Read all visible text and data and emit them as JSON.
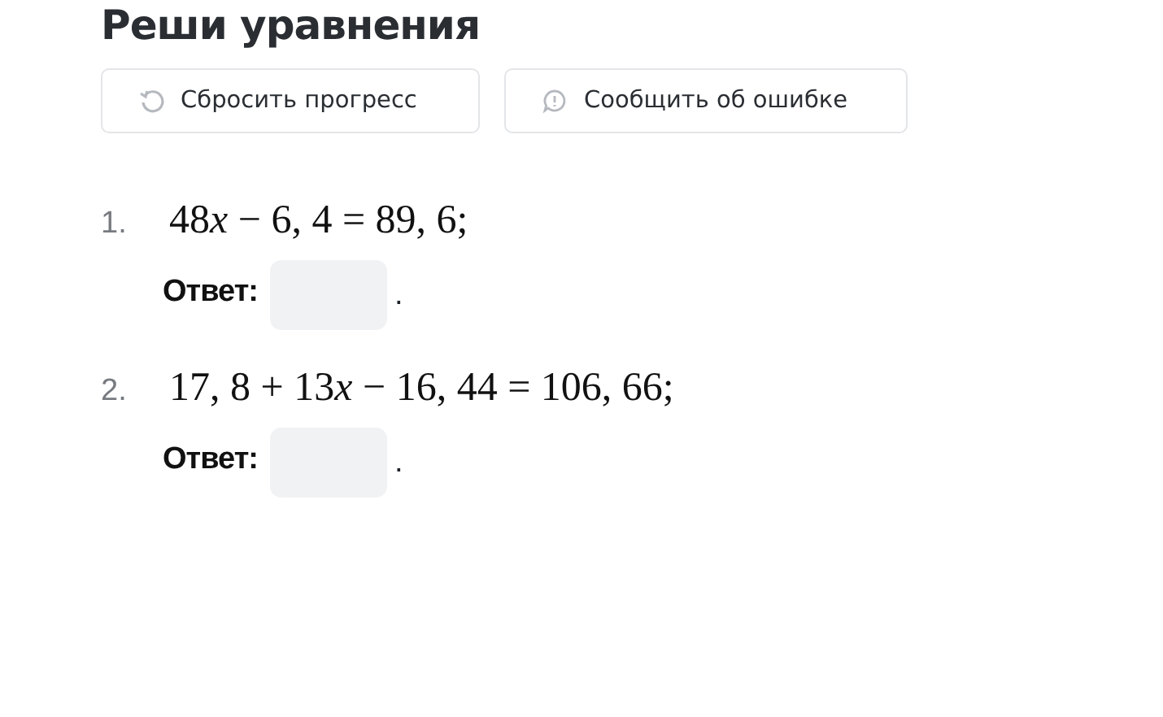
{
  "title": "Реши уравнения",
  "buttons": [
    {
      "kind": "reset",
      "label": "Сбросить прогресс"
    },
    {
      "kind": "report",
      "label": "Сообщить об ошибке"
    }
  ],
  "tasks": [
    {
      "number": "1.",
      "equation": [
        {
          "kind": "text",
          "text": "48"
        },
        {
          "kind": "variable",
          "text": "x"
        },
        {
          "kind": "text",
          "text": " − 6, 4 = 89, 6;"
        }
      ],
      "answer_label": "Ответ:",
      "after": "."
    },
    {
      "number": "2.",
      "equation": [
        {
          "kind": "text",
          "text": "17, 8 + 13"
        },
        {
          "kind": "variable",
          "text": "x"
        },
        {
          "kind": "text",
          "text": " − 16, 44 = 106, 66;"
        }
      ],
      "answer_label": "Ответ:",
      "after": "."
    }
  ]
}
